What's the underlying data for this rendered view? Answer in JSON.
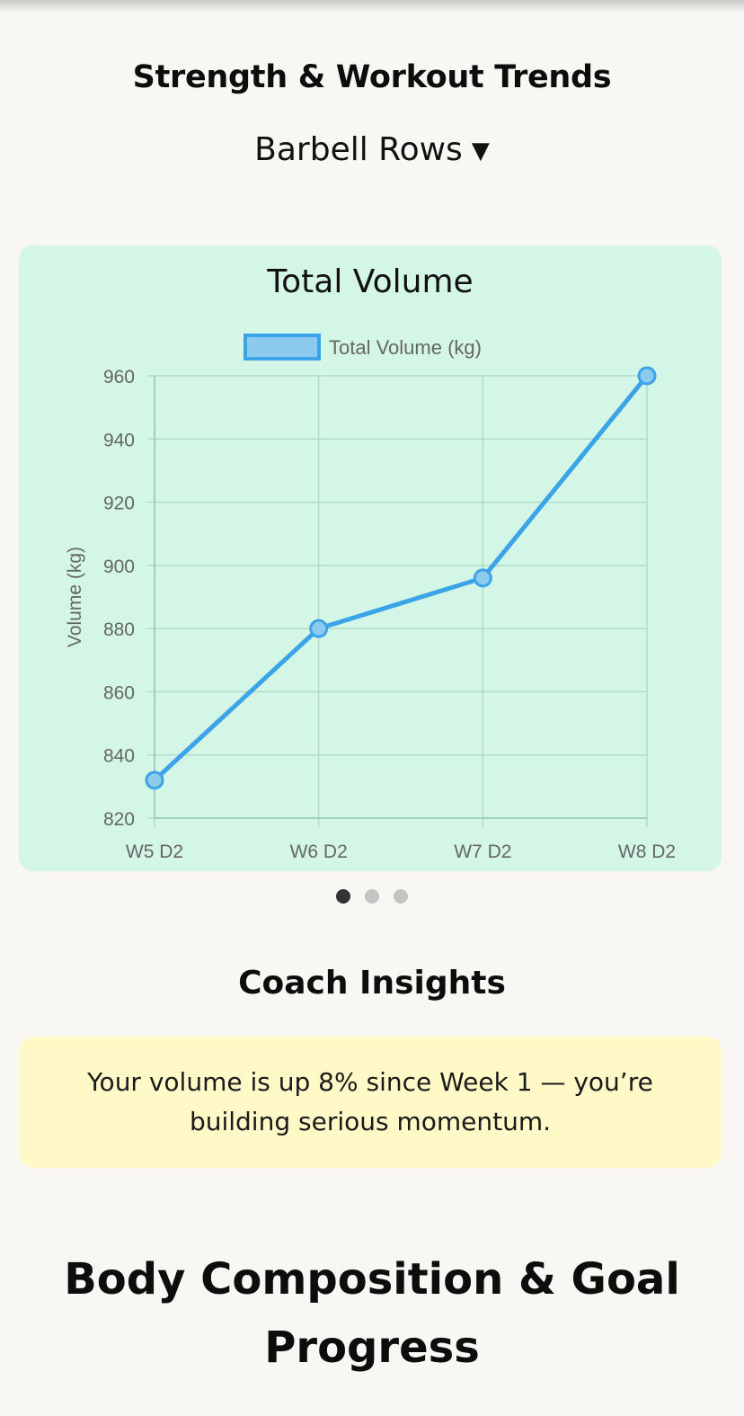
{
  "strength": {
    "title": "Strength & Workout Trends",
    "exercise": "Barbell Rows",
    "caret": "▼"
  },
  "chart_card": {
    "title": "Total Volume"
  },
  "chart_data": {
    "type": "line",
    "categories": [
      "W5 D2",
      "W6 D2",
      "W7 D2",
      "W8 D2"
    ],
    "series": [
      {
        "name": "Total Volume (kg)",
        "values": [
          832,
          880,
          896,
          960
        ]
      }
    ],
    "title": "Total Volume",
    "xlabel": "",
    "ylabel": "Volume (kg)",
    "ylim": [
      820,
      960
    ],
    "yticks": [
      960,
      940,
      920,
      900,
      880,
      860,
      840,
      820
    ],
    "grid": true,
    "legend": "top",
    "colors": {
      "line": "#3ba3e8",
      "point_fill": "#8ccbee",
      "grid": "#b2dbc8"
    }
  },
  "carousel": {
    "count": 3,
    "active_index": 0
  },
  "insights": {
    "title": "Coach Insights",
    "text": "Your volume is up 8% since Week 1 — you’re building serious momentum."
  },
  "body_section": {
    "title": "Body Composition & Goal Progress"
  }
}
